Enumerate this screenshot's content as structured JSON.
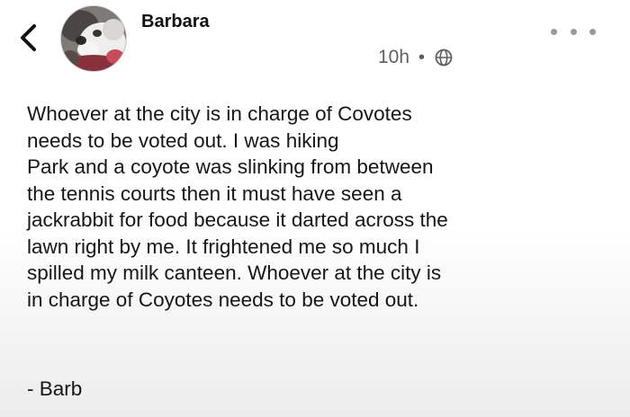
{
  "post": {
    "author": "Barbara",
    "timestamp": "10h",
    "separator": "•",
    "visibility_icon": "globe-icon",
    "more_icon": "more-horizontal-icon",
    "back_icon": "chevron-left-icon",
    "body_lines": [
      "Whoever at the city is in charge of Covotes",
      "needs to be voted out. I was hiking",
      "Park and a coyote was slinking from between",
      "the tennis courts then it must have seen a",
      "jackrabbit for food because it darted across the",
      "lawn right by me. It frightened me so much I",
      "spilled my milk canteen. Whoever at the city is",
      "in charge of Coyotes needs to be voted out."
    ],
    "signature": "- Barb"
  }
}
